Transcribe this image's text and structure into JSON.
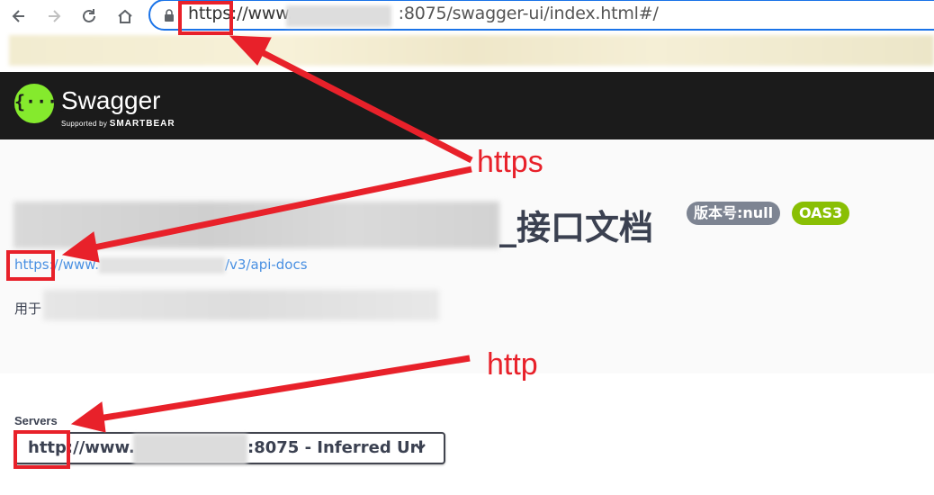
{
  "browser": {
    "url_scheme": "https",
    "url_host_prefix": "://www.",
    "url_rest": ":8075/swagger-ui/index.html#/",
    "icons": [
      "back-icon",
      "forward-icon",
      "reload-icon",
      "home-icon",
      "lock-icon"
    ]
  },
  "swagger": {
    "brand": "Swagger",
    "supported_by": "Supported by",
    "smartbear": "SMARTBEAR"
  },
  "info": {
    "title_suffix": "_接口文档",
    "version_badge": "版本号:null",
    "oas_badge": "OAS3",
    "link_scheme": "https",
    "link_host_prefix": "://www.",
    "link_path": "/v3/api-docs",
    "description_prefix": "用于"
  },
  "servers": {
    "label": "Servers",
    "scheme": "http",
    "host_prefix": "://www.",
    "suffix": ":8075 - Inferred Url"
  },
  "annotations": {
    "https_note": "https",
    "http_note": "http",
    "color": "#e8212a"
  },
  "colors": {
    "topbar": "#1b1b1b",
    "swagger_green": "#85ea2d",
    "oas_badge": "#89bf04",
    "version_badge": "#7d8492",
    "link": "#4990e2"
  }
}
